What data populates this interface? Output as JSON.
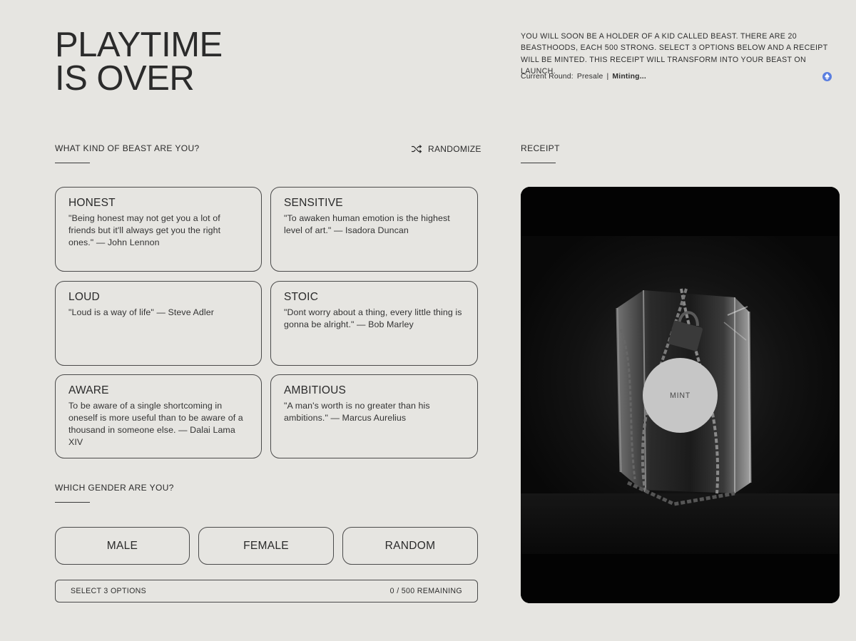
{
  "hero": {
    "title_line1": "PLAYTIME",
    "title_line2": "IS OVER",
    "intro": "YOU WILL SOON BE A HOLDER OF A KID CALLED BEAST. THERE ARE 20 BEASTHOODS, EACH 500 STRONG. SELECT 3 OPTIONS BELOW AND A RECEIPT WILL BE MINTED. THIS RECEIPT WILL TRANSFORM INTO YOUR BEAST ON LAUNCH.",
    "round_label": "Current Round:",
    "round_value": "Presale",
    "separator": "|",
    "status": "Minting...",
    "network_icon": "ethereum-icon"
  },
  "traits": {
    "heading": "WHAT KIND OF BEAST ARE YOU?",
    "randomize_label": "RANDOMIZE",
    "randomize_icon": "shuffle-icon",
    "cards": [
      {
        "title": "HONEST",
        "quote": "\"Being honest may not get you a lot of friends but it'll always get you the right ones.\" — John Lennon"
      },
      {
        "title": "SENSITIVE",
        "quote": "\"To awaken human emotion is the highest level of art.\" — Isadora Duncan"
      },
      {
        "title": "LOUD",
        "quote": "\"Loud is a way of life\" — Steve Adler"
      },
      {
        "title": "STOIC",
        "quote": "\"Dont worry about a thing, every little thing is gonna be alright.\" — Bob Marley"
      },
      {
        "title": "AWARE",
        "quote": "To be aware of a single shortcoming in oneself is more useful than to be aware of a thousand in someone else. — Dalai Lama XIV"
      },
      {
        "title": "AMBITIOUS",
        "quote": "\"A man's worth is no greater than his ambitions.\" — Marcus Aurelius"
      }
    ]
  },
  "gender": {
    "heading": "WHICH GENDER ARE YOU?",
    "options": [
      "MALE",
      "FEMALE",
      "RANDOM"
    ]
  },
  "status_bar": {
    "hint": "SELECT 3 OPTIONS",
    "remaining": "0 / 500 REMAINING"
  },
  "receipt": {
    "heading": "RECEIPT",
    "mint_label": "MINT"
  },
  "colors": {
    "background": "#e6e5e1",
    "text": "#2a2a2a",
    "receipt_bg": "#030303",
    "mint_button": "#c6c6c6",
    "eth_badge": "#5b7fe0"
  }
}
